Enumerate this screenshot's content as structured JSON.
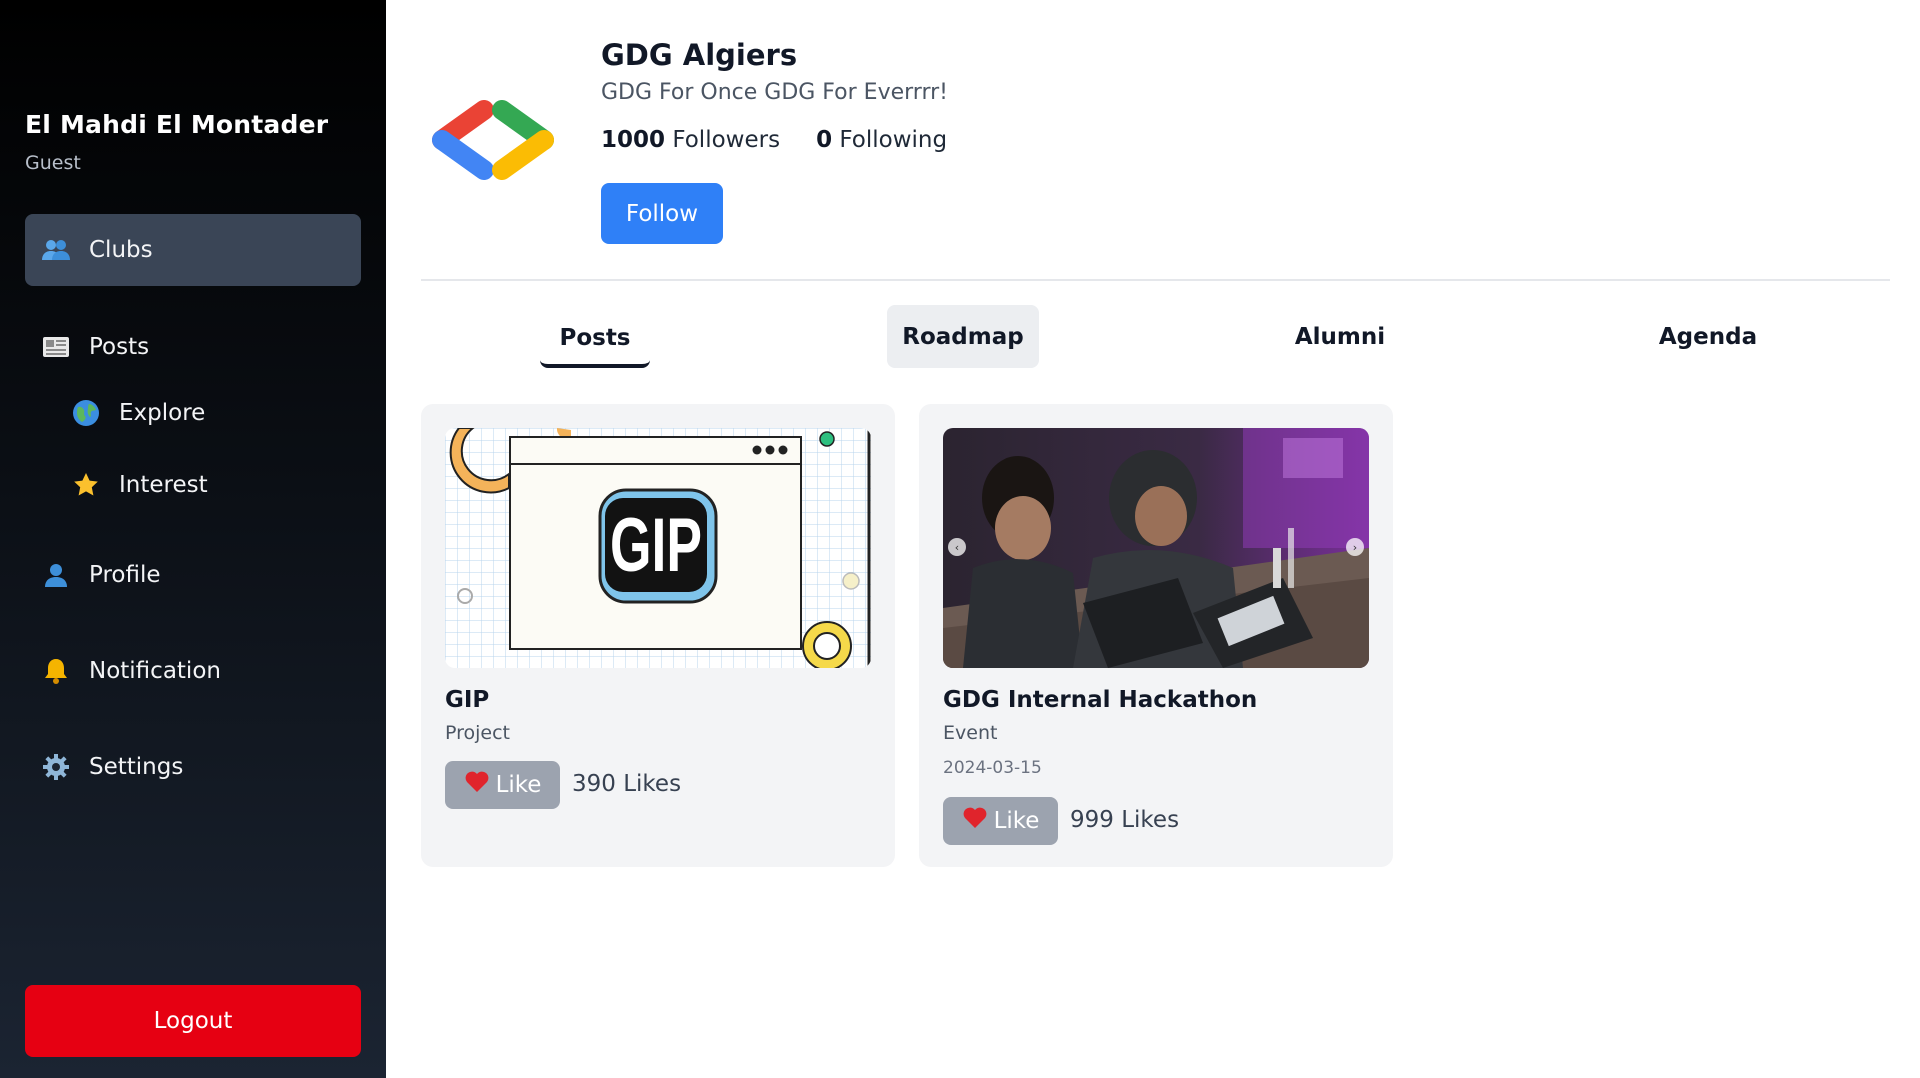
{
  "sidebar": {
    "user_name": "El Mahdi El Montader",
    "user_role": "Guest",
    "items": [
      {
        "label": "Clubs",
        "icon": "users-icon"
      },
      {
        "label": "Posts",
        "icon": "newspaper-icon"
      },
      {
        "label": "Explore",
        "icon": "globe-icon"
      },
      {
        "label": "Interest",
        "icon": "star-icon"
      },
      {
        "label": "Profile",
        "icon": "person-icon"
      },
      {
        "label": "Notification",
        "icon": "bell-icon"
      },
      {
        "label": "Settings",
        "icon": "gear-icon"
      }
    ],
    "logout_label": "Logout"
  },
  "club": {
    "name": "GDG Algiers",
    "tagline": "GDG For Once GDG For Everrrr!",
    "followers_count": "1000",
    "followers_label": "Followers",
    "following_count": "0",
    "following_label": "Following",
    "follow_label": "Follow"
  },
  "tabs": [
    {
      "label": "Posts",
      "active": true
    },
    {
      "label": "Roadmap"
    },
    {
      "label": "Alumni"
    },
    {
      "label": "Agenda"
    }
  ],
  "posts": [
    {
      "title": "GIP",
      "type": "Project",
      "like_label": "Like",
      "likes": "390 Likes",
      "logo_text": "GIP"
    },
    {
      "title": "GDG Internal Hackathon",
      "type": "Event",
      "date": "2024-03-15",
      "like_label": "Like",
      "likes": "999 Likes"
    }
  ],
  "colors": {
    "accent": "#2f80f7",
    "logout": "#e60012",
    "sidebar_active": "#3a4556",
    "like_button": "#9ca3af"
  }
}
